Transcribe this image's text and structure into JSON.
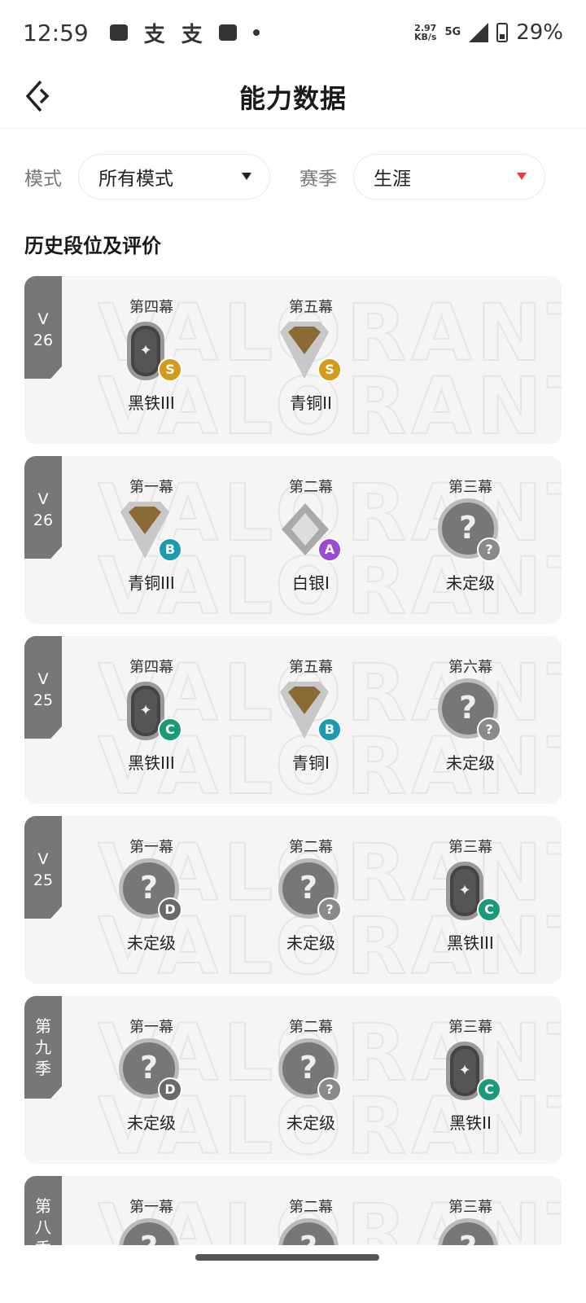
{
  "status_bar": {
    "time": "12:59",
    "icons": [
      "message-icon",
      "alipay-icon",
      "alipay-icon",
      "mail-icon",
      "dot-icon"
    ],
    "net_speed_value": "2.97",
    "net_speed_unit": "KB/s",
    "network": "5G",
    "battery": "29%"
  },
  "header": {
    "title": "能力数据"
  },
  "filters": {
    "mode_label": "模式",
    "mode_value": "所有模式",
    "season_label": "赛季",
    "season_value": "生涯",
    "season_arrow_color": "#e03e3e"
  },
  "section_title": "历史段位及评价",
  "watermark_text": "VALORANT",
  "seasons": [
    {
      "tab_line1": "V",
      "tab_line2": "26",
      "tab_line3": "",
      "acts": [
        {
          "name": "第四幕",
          "rank": "黑铁III",
          "badge": "iron",
          "grade": "S"
        },
        {
          "name": "第五幕",
          "rank": "青铜II",
          "badge": "bronze",
          "grade": "S"
        }
      ]
    },
    {
      "tab_line1": "V",
      "tab_line2": "26",
      "tab_line3": "",
      "acts": [
        {
          "name": "第一幕",
          "rank": "青铜III",
          "badge": "bronze",
          "grade": "B"
        },
        {
          "name": "第二幕",
          "rank": "白银I",
          "badge": "silver",
          "grade": "A"
        },
        {
          "name": "第三幕",
          "rank": "未定级",
          "badge": "unranked",
          "grade": "?"
        }
      ]
    },
    {
      "tab_line1": "V",
      "tab_line2": "25",
      "tab_line3": "",
      "acts": [
        {
          "name": "第四幕",
          "rank": "黑铁III",
          "badge": "iron",
          "grade": "C"
        },
        {
          "name": "第五幕",
          "rank": "青铜I",
          "badge": "bronze",
          "grade": "B"
        },
        {
          "name": "第六幕",
          "rank": "未定级",
          "badge": "unranked",
          "grade": "?"
        }
      ]
    },
    {
      "tab_line1": "V",
      "tab_line2": "25",
      "tab_line3": "",
      "acts": [
        {
          "name": "第一幕",
          "rank": "未定级",
          "badge": "unranked",
          "grade": "D"
        },
        {
          "name": "第二幕",
          "rank": "未定级",
          "badge": "unranked",
          "grade": "?"
        },
        {
          "name": "第三幕",
          "rank": "黑铁III",
          "badge": "iron",
          "grade": "C"
        }
      ]
    },
    {
      "tab_line1": "第",
      "tab_line2": "九",
      "tab_line3": "季",
      "acts": [
        {
          "name": "第一幕",
          "rank": "未定级",
          "badge": "unranked",
          "grade": "D"
        },
        {
          "name": "第二幕",
          "rank": "未定级",
          "badge": "unranked",
          "grade": "?"
        },
        {
          "name": "第三幕",
          "rank": "黑铁II",
          "badge": "iron",
          "grade": "C"
        }
      ]
    },
    {
      "tab_line1": "第",
      "tab_line2": "八",
      "tab_line3": "季",
      "acts": [
        {
          "name": "第一幕",
          "rank": "",
          "badge": "unranked",
          "grade": ""
        },
        {
          "name": "第二幕",
          "rank": "",
          "badge": "unranked",
          "grade": ""
        },
        {
          "name": "第三幕",
          "rank": "",
          "badge": "unranked",
          "grade": ""
        }
      ]
    }
  ]
}
